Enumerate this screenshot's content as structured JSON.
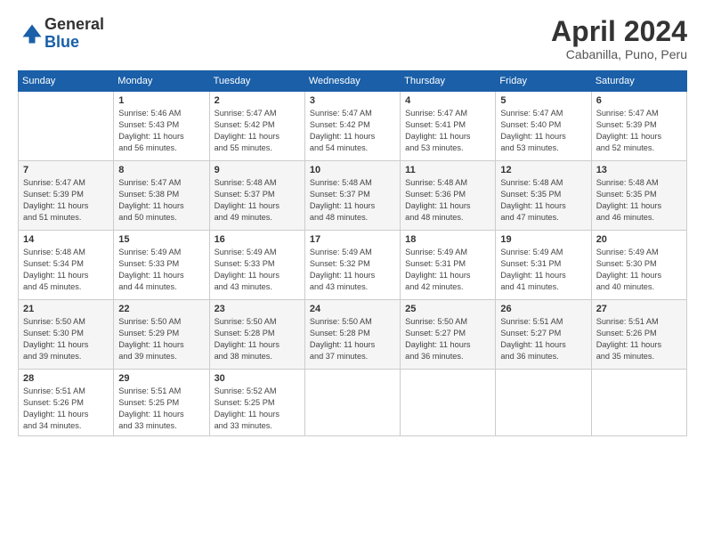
{
  "header": {
    "logo_general": "General",
    "logo_blue": "Blue",
    "title": "April 2024",
    "location": "Cabanilla, Puno, Peru"
  },
  "weekdays": [
    "Sunday",
    "Monday",
    "Tuesday",
    "Wednesday",
    "Thursday",
    "Friday",
    "Saturday"
  ],
  "weeks": [
    [
      {
        "day": "",
        "info": ""
      },
      {
        "day": "1",
        "info": "Sunrise: 5:46 AM\nSunset: 5:43 PM\nDaylight: 11 hours\nand 56 minutes."
      },
      {
        "day": "2",
        "info": "Sunrise: 5:47 AM\nSunset: 5:42 PM\nDaylight: 11 hours\nand 55 minutes."
      },
      {
        "day": "3",
        "info": "Sunrise: 5:47 AM\nSunset: 5:42 PM\nDaylight: 11 hours\nand 54 minutes."
      },
      {
        "day": "4",
        "info": "Sunrise: 5:47 AM\nSunset: 5:41 PM\nDaylight: 11 hours\nand 53 minutes."
      },
      {
        "day": "5",
        "info": "Sunrise: 5:47 AM\nSunset: 5:40 PM\nDaylight: 11 hours\nand 53 minutes."
      },
      {
        "day": "6",
        "info": "Sunrise: 5:47 AM\nSunset: 5:39 PM\nDaylight: 11 hours\nand 52 minutes."
      }
    ],
    [
      {
        "day": "7",
        "info": "Sunrise: 5:47 AM\nSunset: 5:39 PM\nDaylight: 11 hours\nand 51 minutes."
      },
      {
        "day": "8",
        "info": "Sunrise: 5:47 AM\nSunset: 5:38 PM\nDaylight: 11 hours\nand 50 minutes."
      },
      {
        "day": "9",
        "info": "Sunrise: 5:48 AM\nSunset: 5:37 PM\nDaylight: 11 hours\nand 49 minutes."
      },
      {
        "day": "10",
        "info": "Sunrise: 5:48 AM\nSunset: 5:37 PM\nDaylight: 11 hours\nand 48 minutes."
      },
      {
        "day": "11",
        "info": "Sunrise: 5:48 AM\nSunset: 5:36 PM\nDaylight: 11 hours\nand 48 minutes."
      },
      {
        "day": "12",
        "info": "Sunrise: 5:48 AM\nSunset: 5:35 PM\nDaylight: 11 hours\nand 47 minutes."
      },
      {
        "day": "13",
        "info": "Sunrise: 5:48 AM\nSunset: 5:35 PM\nDaylight: 11 hours\nand 46 minutes."
      }
    ],
    [
      {
        "day": "14",
        "info": "Sunrise: 5:48 AM\nSunset: 5:34 PM\nDaylight: 11 hours\nand 45 minutes."
      },
      {
        "day": "15",
        "info": "Sunrise: 5:49 AM\nSunset: 5:33 PM\nDaylight: 11 hours\nand 44 minutes."
      },
      {
        "day": "16",
        "info": "Sunrise: 5:49 AM\nSunset: 5:33 PM\nDaylight: 11 hours\nand 43 minutes."
      },
      {
        "day": "17",
        "info": "Sunrise: 5:49 AM\nSunset: 5:32 PM\nDaylight: 11 hours\nand 43 minutes."
      },
      {
        "day": "18",
        "info": "Sunrise: 5:49 AM\nSunset: 5:31 PM\nDaylight: 11 hours\nand 42 minutes."
      },
      {
        "day": "19",
        "info": "Sunrise: 5:49 AM\nSunset: 5:31 PM\nDaylight: 11 hours\nand 41 minutes."
      },
      {
        "day": "20",
        "info": "Sunrise: 5:49 AM\nSunset: 5:30 PM\nDaylight: 11 hours\nand 40 minutes."
      }
    ],
    [
      {
        "day": "21",
        "info": "Sunrise: 5:50 AM\nSunset: 5:30 PM\nDaylight: 11 hours\nand 39 minutes."
      },
      {
        "day": "22",
        "info": "Sunrise: 5:50 AM\nSunset: 5:29 PM\nDaylight: 11 hours\nand 39 minutes."
      },
      {
        "day": "23",
        "info": "Sunrise: 5:50 AM\nSunset: 5:28 PM\nDaylight: 11 hours\nand 38 minutes."
      },
      {
        "day": "24",
        "info": "Sunrise: 5:50 AM\nSunset: 5:28 PM\nDaylight: 11 hours\nand 37 minutes."
      },
      {
        "day": "25",
        "info": "Sunrise: 5:50 AM\nSunset: 5:27 PM\nDaylight: 11 hours\nand 36 minutes."
      },
      {
        "day": "26",
        "info": "Sunrise: 5:51 AM\nSunset: 5:27 PM\nDaylight: 11 hours\nand 36 minutes."
      },
      {
        "day": "27",
        "info": "Sunrise: 5:51 AM\nSunset: 5:26 PM\nDaylight: 11 hours\nand 35 minutes."
      }
    ],
    [
      {
        "day": "28",
        "info": "Sunrise: 5:51 AM\nSunset: 5:26 PM\nDaylight: 11 hours\nand 34 minutes."
      },
      {
        "day": "29",
        "info": "Sunrise: 5:51 AM\nSunset: 5:25 PM\nDaylight: 11 hours\nand 33 minutes."
      },
      {
        "day": "30",
        "info": "Sunrise: 5:52 AM\nSunset: 5:25 PM\nDaylight: 11 hours\nand 33 minutes."
      },
      {
        "day": "",
        "info": ""
      },
      {
        "day": "",
        "info": ""
      },
      {
        "day": "",
        "info": ""
      },
      {
        "day": "",
        "info": ""
      }
    ]
  ]
}
